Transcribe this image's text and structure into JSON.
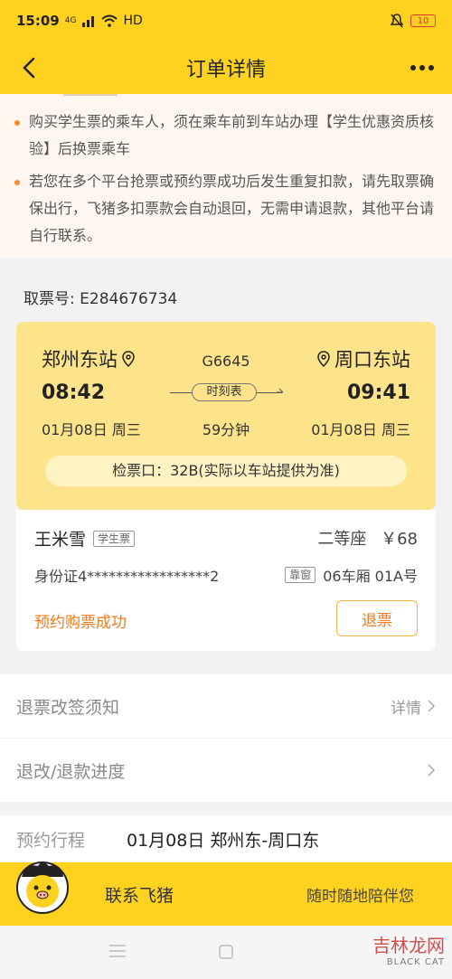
{
  "status": {
    "time": "15:09",
    "network": "4G",
    "hd": "HD",
    "battery": "10"
  },
  "header": {
    "title": "订单详情"
  },
  "notices": [
    "购买学生票的乘车人，须在乘车前到车站办理【学生优惠资质核验】后换票乘车",
    "若您在多个平台抢票或预约票成功后发生重复扣款，请先取票确保出行，飞猪多扣票款会自动退回，无需申请退款，其他平台请自行联系。"
  ],
  "ticket": {
    "ticket_no_label": "取票号: E284676734",
    "from_station": "郑州东站",
    "to_station": "周口东站",
    "train_no": "G6645",
    "depart_time": "08:42",
    "arrive_time": "09:41",
    "timetable_label": "时刻表",
    "depart_date": "01月08日 周三",
    "arrive_date": "01月08日 周三",
    "duration": "59分钟",
    "gate": "检票口：32B(实际以车站提供为准)"
  },
  "passenger": {
    "name": "王米雪",
    "ticket_type": "学生票",
    "seat_class": "二等座",
    "price": "￥68",
    "id_number": "身份证4*****************2",
    "window_tag": "靠窗",
    "car_seat": "06车厢 01A号",
    "status": "预约购票成功",
    "refund_label": "退票"
  },
  "rows": {
    "refund_rules": "退票改签须知",
    "refund_rules_detail": "详情",
    "refund_progress": "退改/退款进度"
  },
  "trip": {
    "label": "预约行程",
    "value": "01月08日 郑州东-周口东"
  },
  "contact": {
    "title": "联系飞猪",
    "subtitle": "随时随地陪伴您"
  },
  "watermark": {
    "text": "吉林龙网",
    "sub": "BLACK CAT"
  },
  "colors": {
    "brand_yellow": "#ffd21f",
    "card_yellow": "#fde48a",
    "accent_orange": "#f07a1a"
  }
}
